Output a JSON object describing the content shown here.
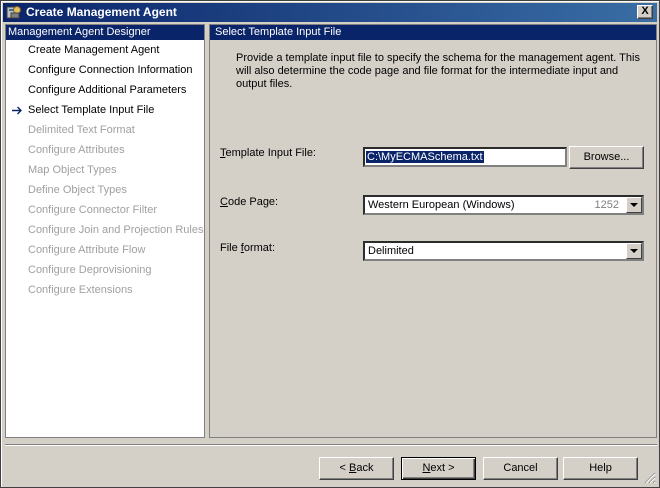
{
  "window": {
    "title": "Create Management Agent",
    "close_symbol": "X"
  },
  "sidebar": {
    "header": "Management Agent Designer",
    "items": [
      {
        "label": "Create Management Agent",
        "state": "enabled"
      },
      {
        "label": "Configure Connection Information",
        "state": "enabled"
      },
      {
        "label": "Configure Additional Parameters",
        "state": "enabled"
      },
      {
        "label": "Select Template Input File",
        "state": "current"
      },
      {
        "label": "Delimited Text Format",
        "state": "disabled"
      },
      {
        "label": "Configure Attributes",
        "state": "disabled"
      },
      {
        "label": "Map Object Types",
        "state": "disabled"
      },
      {
        "label": "Define Object Types",
        "state": "disabled"
      },
      {
        "label": "Configure Connector Filter",
        "state": "disabled"
      },
      {
        "label": "Configure Join and Projection Rules",
        "state": "disabled"
      },
      {
        "label": "Configure Attribute Flow",
        "state": "disabled"
      },
      {
        "label": "Configure Deprovisioning",
        "state": "disabled"
      },
      {
        "label": "Configure Extensions",
        "state": "disabled"
      }
    ]
  },
  "main": {
    "header": "Select Template Input File",
    "description": "Provide a template input file to specify the schema for the management agent. This will also determine the code page and file format for the intermediate input and output files.",
    "template_input": {
      "label_prefix": "",
      "label_mnemonic": "T",
      "label_rest": "emplate Input File:",
      "value": "C:\\MyECMASchema.txt",
      "browse_label": "Browse..."
    },
    "code_page": {
      "label_mnemonic": "C",
      "label_rest": "ode Page:",
      "value": "Western European (Windows)",
      "code": "1252"
    },
    "file_format": {
      "label_prefix": "File ",
      "label_mnemonic": "f",
      "label_rest": "ormat:",
      "value": "Delimited"
    }
  },
  "footer": {
    "back_prefix": "< ",
    "back_mnemonic": "B",
    "back_rest": "ack",
    "next_mnemonic": "N",
    "next_rest": "ext >",
    "cancel_label": "Cancel",
    "help_label": "Help"
  },
  "colors": {
    "title_bar": "#0a246a",
    "panel_header": "#0a246a",
    "disabled_text": "#a0a0a0",
    "window_bg": "#d4d0c8"
  },
  "icons": {
    "title": "agent-wizard-icon",
    "current_step": "arrow-right-icon"
  }
}
